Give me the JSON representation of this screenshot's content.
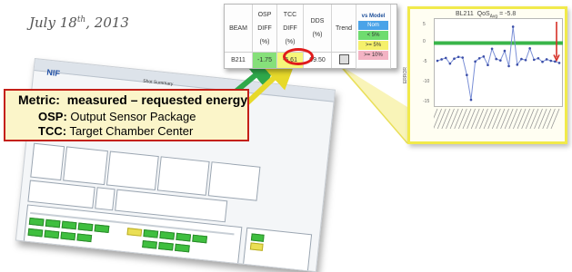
{
  "date": {
    "text": "July 18",
    "sup": "th",
    "rest": ", 2013"
  },
  "report": {
    "logo": "NIF",
    "title": "Shot Summary"
  },
  "callout": {
    "metric_label": "Metric:",
    "metric_text": "measured – requested energy",
    "osp_label": "OSP:",
    "osp_text": "Output Sensor Package",
    "tcc_label": "TCC:",
    "tcc_text": "Target Chamber Center"
  },
  "table": {
    "headers": {
      "beam": "BEAM",
      "osp": [
        "OSP",
        "DIFF",
        "(%)"
      ],
      "tcc": [
        "TCC",
        "DIFF",
        "(%)"
      ],
      "dds": [
        "DDS",
        "(%)"
      ],
      "trend": "Trend"
    },
    "vs_model": {
      "title": "vs Model",
      "levels": [
        "Nom",
        "< 5%",
        ">= 5%",
        ">= 10%"
      ]
    },
    "row": {
      "beam": "B211",
      "osp": "-1.75",
      "tcc": "-5.61",
      "dds": "99.50"
    }
  },
  "plot": {
    "title": "BL211",
    "yticks": [
      "5",
      "0",
      "-5",
      "-10",
      "-15"
    ],
    "ylabel": "ERROR"
  },
  "chart_data": {
    "type": "line",
    "title": "BL211",
    "ylim": [
      -17,
      6
    ],
    "values": [
      -5,
      -4.6,
      -4.2,
      -5.8,
      -4.4,
      -3.9,
      -4.1,
      -9,
      -16,
      -5.2,
      -4.3,
      -3.8,
      -6.2,
      -1.6,
      -4.5,
      -4.9,
      -2.2,
      -6.5,
      4.6,
      -6.1,
      -4.5,
      -4.8,
      -1.5,
      -4.7,
      -4.3,
      -5.3,
      -4.6,
      -5.0,
      -5.2,
      -5.61
    ],
    "reference_band": 0,
    "colors": {
      "line": "#7a8fd6",
      "band": "#39b54a",
      "arrow": "#d63027"
    }
  }
}
